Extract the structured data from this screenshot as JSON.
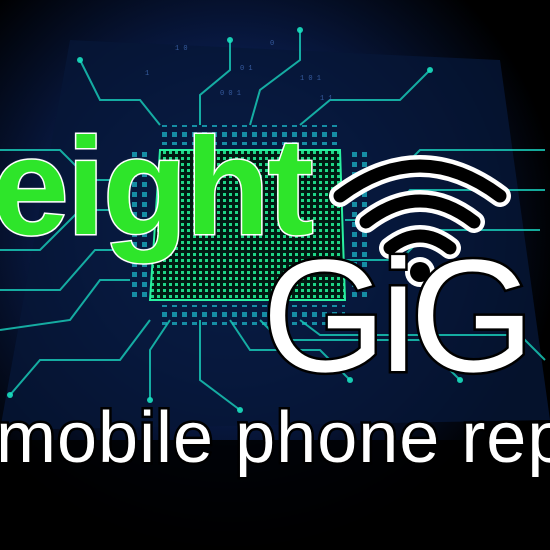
{
  "logo": {
    "word_top": "eight",
    "word_main": "GiG",
    "tagline": "mobile phone repair",
    "icon": "wifi-icon"
  },
  "colors": {
    "background": "#000000",
    "circuit_glow": "#16d9b0",
    "circuit_dark": "#0a2a5e",
    "eight_fill": "#2ee52a",
    "text_outline_white": "#ffffff",
    "text_fill_white": "#ffffff",
    "wifi": "#000000"
  }
}
